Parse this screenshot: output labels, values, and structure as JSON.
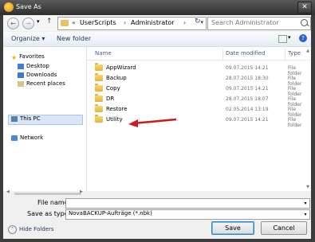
{
  "window": {
    "title": "Save As",
    "close_glyph": "✕"
  },
  "nav": {
    "back_glyph": "←",
    "forward_glyph": "→",
    "recent_glyph": "▾",
    "up_glyph": "↑",
    "breadcrumb_prefix": "«",
    "breadcrumb": [
      "UserScripts",
      "Administrator"
    ],
    "separator": "›",
    "dropdown_glyph": "▾",
    "refresh_glyph": "↻",
    "search_placeholder": "Search Administrator"
  },
  "toolbar": {
    "organize_label": "Organize ▾",
    "new_folder_label": "New folder",
    "view_dd_glyph": "▾",
    "help_glyph": "?"
  },
  "sidebar": {
    "favorites_label": "Favorites",
    "favorites_items": [
      "Desktop",
      "Downloads",
      "Recent places"
    ],
    "this_pc_label": "This PC",
    "network_label": "Network"
  },
  "columns": {
    "name": "Name",
    "date": "Date modified",
    "type": "Type"
  },
  "files": [
    {
      "name": "AppWizard",
      "date": "09.07.2015 14:21",
      "type": "File folder"
    },
    {
      "name": "Backup",
      "date": "28.07.2015 18:30",
      "type": "File folder"
    },
    {
      "name": "Copy",
      "date": "09.07.2015 14:21",
      "type": "File folder"
    },
    {
      "name": "DR",
      "date": "28.07.2015 18:07",
      "type": "File folder"
    },
    {
      "name": "Restore",
      "date": "02.05.2014 13:19",
      "type": "File folder"
    },
    {
      "name": "Utility",
      "date": "09.07.2015 14:21",
      "type": "File folder"
    }
  ],
  "form": {
    "file_name_label": "File name:",
    "file_name_value": "",
    "save_type_label": "Save as type:",
    "save_type_value": "NovaBACKUP-Aufträge (*.nbk)",
    "dropdown_glyph": "▾"
  },
  "footer": {
    "hide_folders_label": "Hide Folders",
    "hide_glyph": "˄",
    "save_label": "Save",
    "cancel_label": "Cancel"
  },
  "annotation": {
    "arrow_color": "#d0181e"
  }
}
